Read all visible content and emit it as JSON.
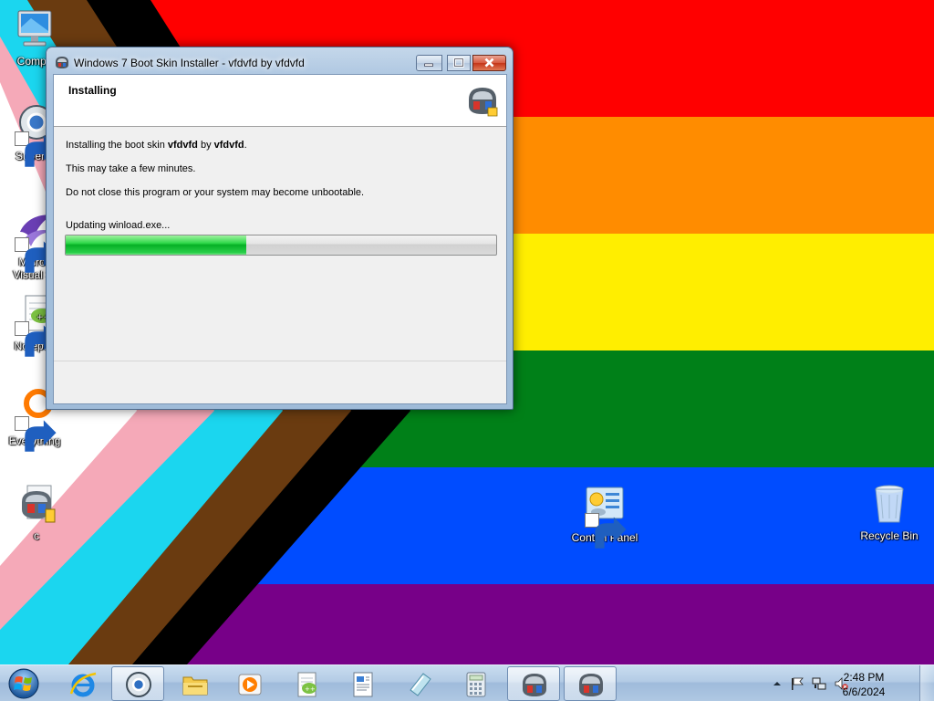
{
  "desktop": {
    "icons": [
      {
        "label": "Compu",
        "icon": "computer-icon"
      },
      {
        "label": "Superm",
        "icon": "supermium-icon"
      },
      {
        "label": "Micros",
        "label2": "Visual St",
        "icon": "visual-studio-icon"
      },
      {
        "label": "Notepac",
        "icon": "notepad-plus-plus-icon"
      },
      {
        "label": "Everything",
        "icon": "everything-search-icon"
      },
      {
        "label": "c",
        "icon": "boot-skin-installer-icon"
      },
      {
        "label": "Control Panel",
        "icon": "control-panel-icon"
      },
      {
        "label": "Recycle Bin",
        "icon": "recycle-bin-icon"
      }
    ]
  },
  "window": {
    "title": "Windows 7 Boot Skin Installer - vfdvfd by vfdvfd",
    "header_title": "Installing",
    "line1_prefix": "Installing the boot skin ",
    "skin_name": "vfdvfd",
    "line1_by": " by ",
    "author_name": "vfdvfd",
    "line1_suffix": ".",
    "line2": "This may take a few minutes.",
    "line3": "Do not close this program or your system may become unbootable.",
    "status": "Updating winload.exe...",
    "progress_fraction": 0.42
  },
  "taskbar": {
    "pinned": [
      {
        "icon": "internet-explorer-icon",
        "active": false
      },
      {
        "icon": "supermium-browser-icon",
        "active": true
      },
      {
        "icon": "file-explorer-icon",
        "active": false
      },
      {
        "icon": "media-player-icon",
        "active": false
      },
      {
        "icon": "notepad-plus-plus-icon",
        "active": false
      },
      {
        "icon": "wordpad-icon",
        "active": false
      },
      {
        "icon": "snipping-tool-icon",
        "active": false
      },
      {
        "icon": "calculator-icon",
        "active": false
      },
      {
        "icon": "boot-skin-installer-icon",
        "active": true
      },
      {
        "icon": "boot-skin-installer-icon",
        "active": true
      }
    ],
    "clock_time": "2:48 PM",
    "clock_date": "6/6/2024"
  },
  "colors": {
    "flag_red": "#ff0000",
    "flag_orange": "#ff8c00",
    "flag_yellow": "#ffee00",
    "flag_green": "#008018",
    "flag_blue": "#004cff",
    "flag_purple": "#770088",
    "chevron_pink": "#f5a9b8",
    "chevron_cyan": "#1bd6ef",
    "chevron_brown": "#6a3b10",
    "progress_green": "#06b025"
  }
}
